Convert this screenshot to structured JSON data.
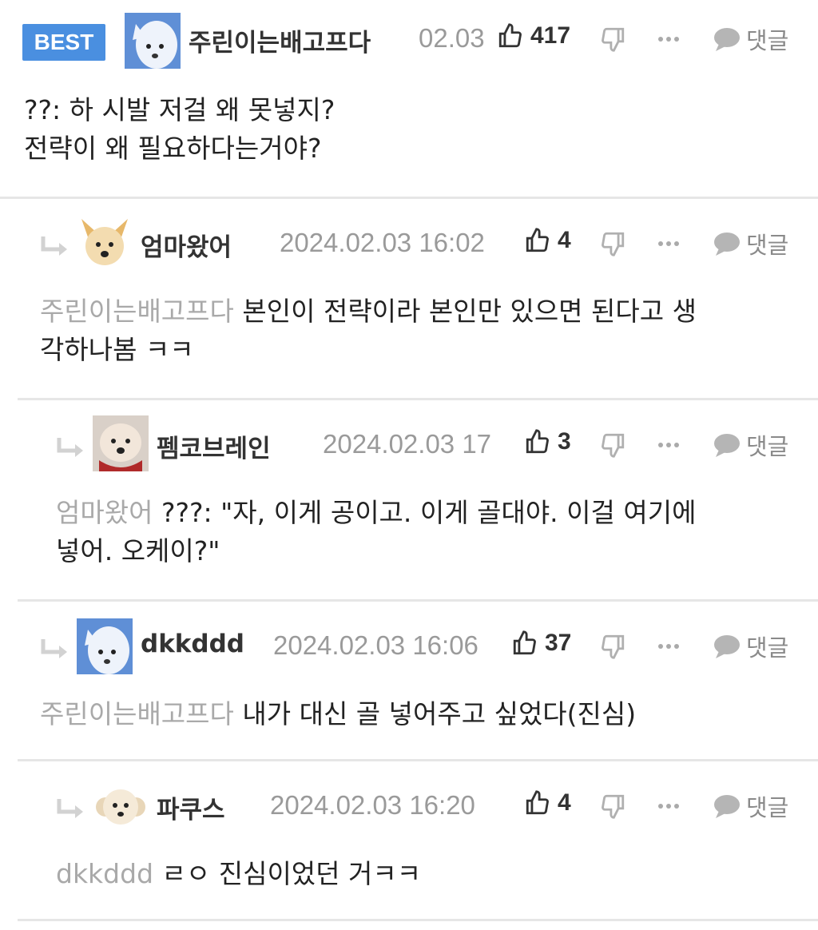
{
  "comments": [
    {
      "badge": "BEST",
      "nick": "주린이는배고프다",
      "date": "02.03",
      "likes": "417",
      "reply_label": "댓글",
      "mention": "",
      "text_lines": [
        "??: 하 시발 저걸 왜 못넣지?",
        "전략이 왜 필요하다는거야?"
      ],
      "avatar": "white-fox-avatar"
    },
    {
      "nick": "엄마왔어",
      "date": "2024.02.03 16:02",
      "likes": "4",
      "reply_label": "댓글",
      "mention": "주린이는배고프다",
      "text_lines": [
        "본인이 전략이라 본인만 있으면 된다고 생",
        "각하나봄 ㅋㅋ"
      ],
      "avatar": "shiba-avatar"
    },
    {
      "nick": "펨코브레인",
      "date": "2024.02.03 17",
      "likes": "3",
      "reply_label": "댓글",
      "mention": "엄마왔어",
      "text_lines": [
        "???: \"자, 이게 공이고. 이게 골대야. 이걸 여기에",
        "넣어. 오케이?\""
      ],
      "avatar": "puppy-avatar"
    },
    {
      "nick": "dkkddd",
      "date": "2024.02.03 16:06",
      "likes": "37",
      "reply_label": "댓글",
      "mention": "주린이는배고프다",
      "text_lines": [
        "내가 대신 골 넣어주고 싶었다(진심)"
      ],
      "avatar": "white-fox-avatar"
    },
    {
      "nick": "파쿠스",
      "date": "2024.02.03 16:20",
      "likes": "4",
      "reply_label": "댓글",
      "mention": "dkkddd",
      "text_lines": [
        "ㄹㅇ 진심이었던 거ㅋㅋ"
      ],
      "avatar": "maltese-avatar"
    }
  ]
}
